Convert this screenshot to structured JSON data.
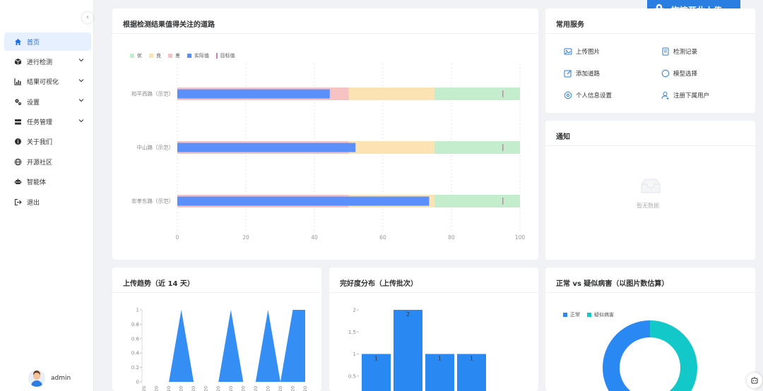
{
  "sidebar": {
    "items": [
      {
        "label": "首页",
        "icon": "home-icon",
        "active": true
      },
      {
        "label": "进行检测",
        "icon": "box-icon",
        "expandable": true
      },
      {
        "label": "结果可视化",
        "icon": "chart-icon",
        "expandable": true
      },
      {
        "label": "设置",
        "icon": "gear-icon",
        "expandable": true
      },
      {
        "label": "任务管理",
        "icon": "tasks-icon",
        "expandable": true
      },
      {
        "label": "关于我们",
        "icon": "info-icon"
      },
      {
        "label": "开源社区",
        "icon": "globe-icon"
      },
      {
        "label": "智能体",
        "icon": "robot-icon"
      },
      {
        "label": "退出",
        "icon": "logout-icon"
      }
    ],
    "user": {
      "name": "admin"
    }
  },
  "upload_badge": {
    "label": "拖拽至此上传"
  },
  "roads_card": {
    "title": "根据检测结果值得关注的道路"
  },
  "services": {
    "title": "常用服务",
    "items": [
      {
        "label": "上传图片",
        "icon": "image-upload-icon"
      },
      {
        "label": "检测记录",
        "icon": "record-icon"
      },
      {
        "label": "添加道路",
        "icon": "edit-road-icon"
      },
      {
        "label": "模型选择",
        "icon": "circle-icon"
      },
      {
        "label": "个人信息设置",
        "icon": "settings-icon"
      },
      {
        "label": "注册下属用户",
        "icon": "user-add-icon"
      }
    ]
  },
  "notice": {
    "title": "通知",
    "empty_text": "暂无数据"
  },
  "trend_card": {
    "title": "上传趋势（近 14 天）"
  },
  "dist_card": {
    "title": "完好度分布（上传批次）"
  },
  "pie_card": {
    "title": "正常 vs 疑似病害（以图片数估算）"
  },
  "colors": {
    "accent": "#2a7de1",
    "excellent": "#c3edcc",
    "good": "#fbe3b3",
    "poor": "#f6c3c2",
    "actual": "#5b8ff9",
    "target": "#d97bb0",
    "bar": "#2a88f2",
    "teal": "#12c8c8"
  },
  "chart_data": [
    {
      "type": "bar",
      "orientation": "horizontal",
      "categories": [
        "和平西路（示范）",
        "中山路（示范）",
        "忠孝东路（示范）"
      ],
      "bands": [
        {
          "name": "优",
          "range": [
            75,
            100
          ]
        },
        {
          "name": "良",
          "range": [
            50,
            75
          ]
        },
        {
          "name": "差",
          "range": [
            0,
            50
          ]
        }
      ],
      "series": [
        {
          "name": "实际值",
          "values": [
            44.5,
            52,
            73.5
          ]
        },
        {
          "name": "目标值",
          "values": [
            95,
            95,
            95
          ]
        }
      ],
      "xlim": [
        0,
        100
      ],
      "xticks": [
        0,
        20,
        40,
        60,
        80,
        100
      ],
      "legend": "top-left"
    },
    {
      "type": "area",
      "yticks": [
        "1",
        "0.8",
        "0.6",
        "0.4",
        "0.2",
        "0"
      ],
      "ylim": [
        0,
        1
      ],
      "x_count": 14,
      "x_tick_label": "20",
      "values": [
        0,
        0,
        0,
        1,
        0,
        0,
        0,
        1,
        0,
        0,
        1,
        0,
        1,
        1
      ]
    },
    {
      "type": "bar",
      "yticks": [
        "2",
        "1.5",
        "1",
        "0.5"
      ],
      "ylim": [
        0,
        2
      ],
      "values": [
        1,
        2,
        1,
        1
      ],
      "data_labels": [
        "1",
        "2",
        "1",
        "1"
      ]
    },
    {
      "type": "pie",
      "series": [
        {
          "name": "正常",
          "value": 50
        },
        {
          "name": "疑似病害",
          "value": 50
        }
      ],
      "legend": "top-left"
    }
  ]
}
